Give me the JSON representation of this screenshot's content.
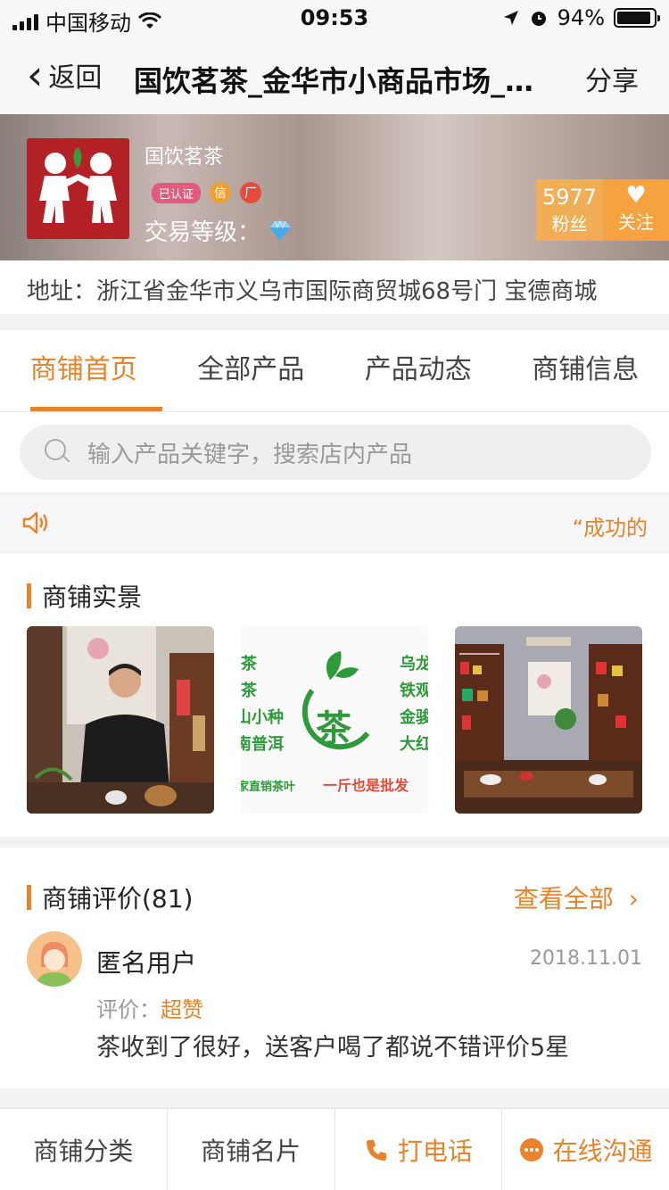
{
  "status_bar": {
    "carrier": "中国移动",
    "time": "09:53",
    "battery": "94%"
  },
  "nav": {
    "back_label": "返回",
    "title": "国饮茗茶_金华市小商品市场_金华市小商品市场",
    "share_label": "分享"
  },
  "shop": {
    "name": "国饮茗茶",
    "badge_auth": "已认证",
    "badge_xin": "信",
    "badge_chang": "厂",
    "level_label": "交易等级：",
    "fans_count": "5977",
    "fans_label": "粉丝",
    "follow_label": "关注",
    "address": "地址：浙江省金华市义乌市国际商贸城68号门 宝德商城"
  },
  "tabs": [
    {
      "label": "商铺首页",
      "active": true
    },
    {
      "label": "全部产品"
    },
    {
      "label": "产品动态"
    },
    {
      "label": "商铺信息"
    }
  ],
  "search": {
    "placeholder": "输入产品关键字，搜索店内产品"
  },
  "notice": {
    "text": "“成功的"
  },
  "store_scene": {
    "title": "商铺实景",
    "sign": {
      "left_col": [
        "茶",
        "茶",
        "山小种",
        "南普洱"
      ],
      "center_char": "茶",
      "right_col": [
        "乌龙",
        "铁观",
        "金骏",
        "大红"
      ],
      "footer_left": "家直销茶叶",
      "footer_right": "一斤也是批发"
    }
  },
  "reviews": {
    "title": "商铺评价(81)",
    "view_all": "查看全部",
    "items": [
      {
        "user": "匿名用户",
        "date": "2018.11.01",
        "rating_label": "评价：",
        "rating_value": "超赞",
        "comment": "茶收到了很好，送客户喝了都说不错评价5星"
      }
    ]
  },
  "bottom_bar": {
    "category": "商铺分类",
    "card": "商铺名片",
    "call": "打电话",
    "chat": "在线沟通"
  },
  "colors": {
    "accent": "#e8832b",
    "brand_red": "#b32025"
  }
}
